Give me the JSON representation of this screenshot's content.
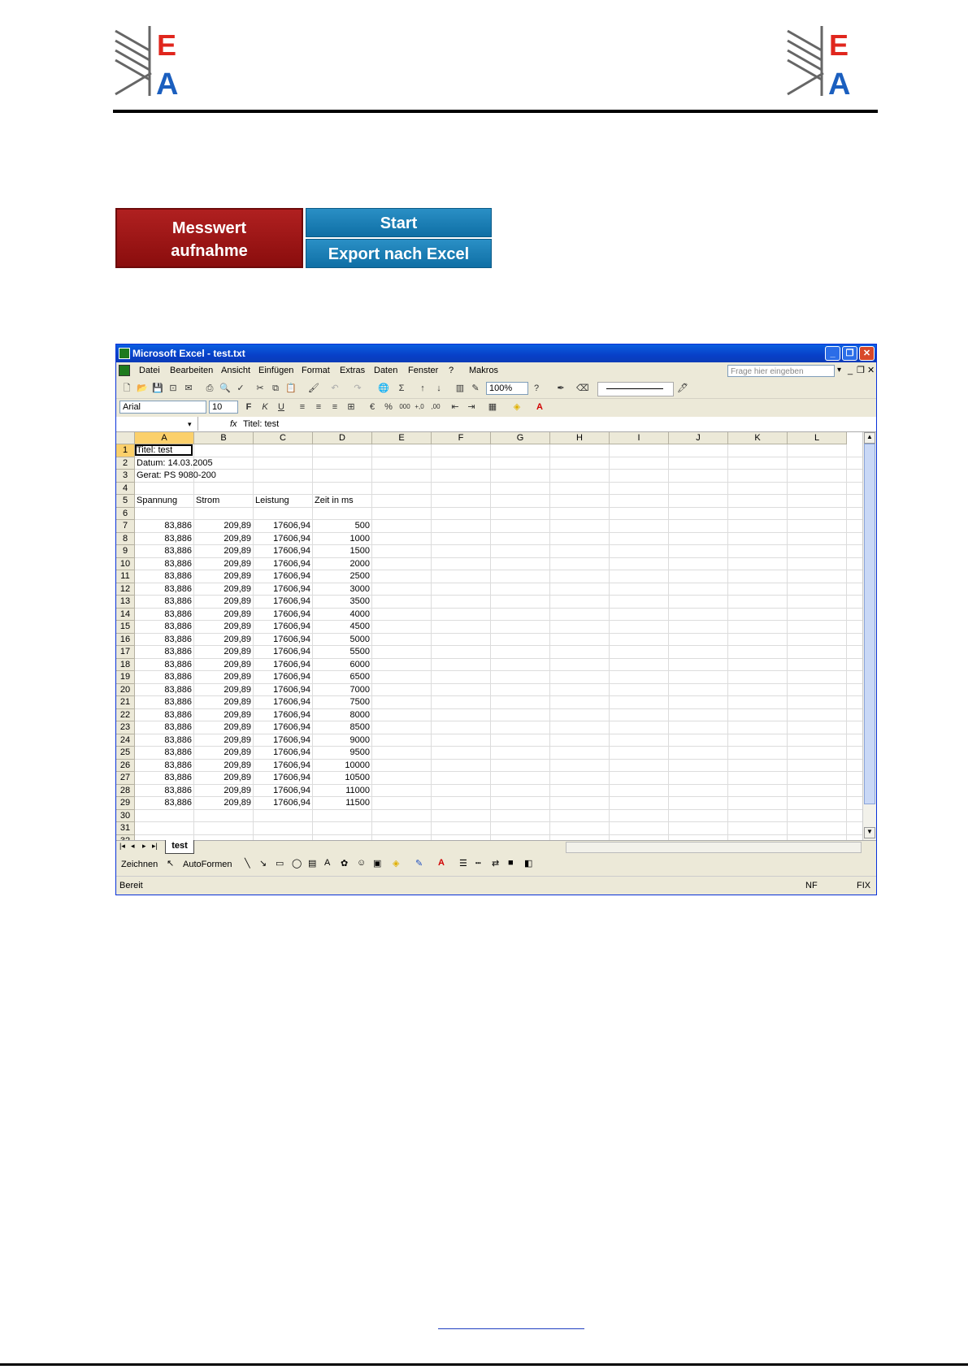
{
  "logo": {
    "letter_top": "E",
    "letter_bottom": "A"
  },
  "buttons": {
    "record_line1": "Messwert",
    "record_line2": "aufnahme",
    "start": "Start",
    "export": "Export nach Excel"
  },
  "excel": {
    "title": "Microsoft Excel - test.txt",
    "menu": [
      "Datei",
      "Bearbeiten",
      "Ansicht",
      "Einfügen",
      "Format",
      "Extras",
      "Daten",
      "Fenster",
      "?",
      "Makros"
    ],
    "help_placeholder": "Frage hier eingeben",
    "zoom": "100%",
    "font_name": "Arial",
    "font_size": "10",
    "fx": "fx",
    "formula": "Titel: test",
    "columns": [
      "A",
      "B",
      "C",
      "D",
      "E",
      "F",
      "G",
      "H",
      "I",
      "J",
      "K",
      "L"
    ],
    "rows": [
      [
        "Titel: test",
        "",
        "",
        ""
      ],
      [
        "Datum: 14.03.2005",
        "",
        "",
        ""
      ],
      [
        "Gerat: PS 9080-200",
        "",
        "",
        ""
      ],
      [
        "",
        "",
        "",
        ""
      ],
      [
        "Spannung",
        "Strom",
        "Leistung",
        "Zeit in ms"
      ],
      [
        "",
        "",
        "",
        ""
      ],
      [
        "83,886",
        "209,89",
        "17606,94",
        "500"
      ],
      [
        "83,886",
        "209,89",
        "17606,94",
        "1000"
      ],
      [
        "83,886",
        "209,89",
        "17606,94",
        "1500"
      ],
      [
        "83,886",
        "209,89",
        "17606,94",
        "2000"
      ],
      [
        "83,886",
        "209,89",
        "17606,94",
        "2500"
      ],
      [
        "83,886",
        "209,89",
        "17606,94",
        "3000"
      ],
      [
        "83,886",
        "209,89",
        "17606,94",
        "3500"
      ],
      [
        "83,886",
        "209,89",
        "17606,94",
        "4000"
      ],
      [
        "83,886",
        "209,89",
        "17606,94",
        "4500"
      ],
      [
        "83,886",
        "209,89",
        "17606,94",
        "5000"
      ],
      [
        "83,886",
        "209,89",
        "17606,94",
        "5500"
      ],
      [
        "83,886",
        "209,89",
        "17606,94",
        "6000"
      ],
      [
        "83,886",
        "209,89",
        "17606,94",
        "6500"
      ],
      [
        "83,886",
        "209,89",
        "17606,94",
        "7000"
      ],
      [
        "83,886",
        "209,89",
        "17606,94",
        "7500"
      ],
      [
        "83,886",
        "209,89",
        "17606,94",
        "8000"
      ],
      [
        "83,886",
        "209,89",
        "17606,94",
        "8500"
      ],
      [
        "83,886",
        "209,89",
        "17606,94",
        "9000"
      ],
      [
        "83,886",
        "209,89",
        "17606,94",
        "9500"
      ],
      [
        "83,886",
        "209,89",
        "17606,94",
        "10000"
      ],
      [
        "83,886",
        "209,89",
        "17606,94",
        "10500"
      ],
      [
        "83,886",
        "209,89",
        "17606,94",
        "11000"
      ],
      [
        "83,886",
        "209,89",
        "17606,94",
        "11500"
      ],
      [
        "",
        "",
        "",
        ""
      ],
      [
        "",
        "",
        "",
        ""
      ],
      [
        "",
        "",
        "",
        ""
      ]
    ],
    "sheet_tab": "test",
    "draw_label": "Zeichnen",
    "autoshapes_label": "AutoFormen",
    "status_ready": "Bereit",
    "status_nf": "NF",
    "status_fix": "FIX"
  },
  "colors": {
    "brand_red": "#e0261d",
    "brand_blue": "#1b5fbf",
    "excel_blue": "#0a4fd8"
  }
}
